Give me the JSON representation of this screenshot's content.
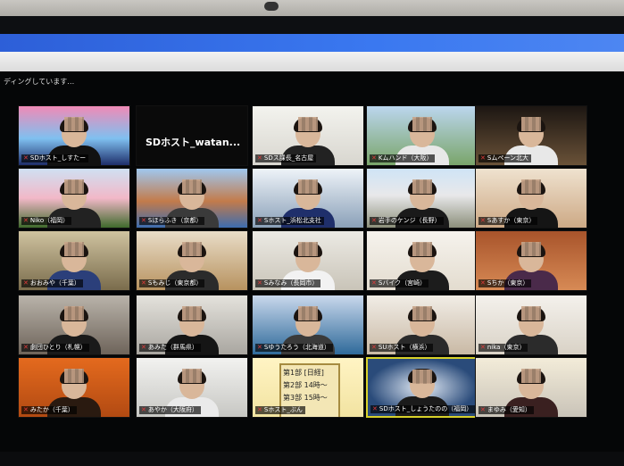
{
  "recording_text": "ディングしています…",
  "tiles": [
    {
      "name": "SDホスト_しすたー",
      "bg": "linear-gradient(#f08ab6,#7fc0f0 55%,#1e2e6a)",
      "shirt": "#111"
    },
    {
      "name": "",
      "big": "SDホスト_watan...",
      "bg": "#0a0a0a",
      "noperson": true
    },
    {
      "name": "SDス課長_名古屋",
      "bg": "linear-gradient(#f3f3ee,#d8d6cf)",
      "shirt": "#222"
    },
    {
      "name": "Kムハンド（大阪）",
      "bg": "linear-gradient(#bcd6ee,#7aa56a)",
      "shirt": "#e8e8e8"
    },
    {
      "name": "Sムペーン北大",
      "bg": "linear-gradient(#1c1612,#6a5238)",
      "shirt": "#e8e8e8"
    },
    {
      "name": "Niko（福岡）",
      "bg": "linear-gradient(#cfe0f2,#f2b8c8 50%,#3f6a2c)",
      "shirt": "#222"
    },
    {
      "name": "Sほらふき（京都）",
      "bg": "linear-gradient(#9fc7ef,#c37b4b 55%,#3d6db0)",
      "shirt": "#3a3a3a"
    },
    {
      "name": "Sホスト_浜松北支社",
      "bg": "linear-gradient(#eef3f8,#8aa0b8)",
      "shirt": "#1f2f6b"
    },
    {
      "name": "岩手のケンジ（長野）",
      "bg": "linear-gradient(#cfe4f6,#e8e8ea 45%,#8b8f7a)",
      "shirt": "#1a1a1a"
    },
    {
      "name": "Sあすか（東京）",
      "bg": "linear-gradient(#efe2cf,#cda985)",
      "shirt": "#151515"
    },
    {
      "name": "おおみや（千葉）",
      "bg": "linear-gradient(#cfc3a0,#7a6c4c)",
      "shirt": "#2b3f7a"
    },
    {
      "name": "Sもみじ（東京都）",
      "bg": "linear-gradient(#e9ddc8,#b7925f)",
      "shirt": "#2b2b2b"
    },
    {
      "name": "Sみなみ（長岡市）",
      "bg": "linear-gradient(#eceae4,#c9c4b8)",
      "shirt": "#f2f2f2"
    },
    {
      "name": "Sバイク（宮崎）",
      "bg": "linear-gradient(#f6f3ed,#e3dccf)",
      "shirt": "#1c1c1c"
    },
    {
      "name": "Sちか（東京）",
      "bg": "linear-gradient(#a8542b,#d78a55)",
      "shirt": "#4a2a4a"
    },
    {
      "name": "劇団ひとり（札幌）",
      "bg": "linear-gradient(#b9b3aa,#6e645a)",
      "shirt": "#1a1a1a"
    },
    {
      "name": "あみた（群馬県）",
      "bg": "linear-gradient(#e4e2dc,#a9a6a0)",
      "shirt": "#151515"
    },
    {
      "name": "Sゆうたろう（北海道）",
      "bg": "linear-gradient(#c9d8ec,#2f6a9a)",
      "shirt": "#3a3a3a"
    },
    {
      "name": "SUホスト（横浜）",
      "bg": "linear-gradient(#f1ede6,#c9b9a5)",
      "shirt": "#2a2a2a"
    },
    {
      "name": "nika（東京）",
      "bg": "linear-gradient(#f4f1ec,#d9d2c6)",
      "shirt": "#2b2b2b"
    },
    {
      "name": "みたか（千葉）",
      "bg": "linear-gradient(#e46a1e,#b24a12)",
      "shirt": "#2a1a10"
    },
    {
      "name": "あやか（大阪府）",
      "bg": "linear-gradient(#f2f2f0,#c7c7c3)",
      "shirt": "#eaeaea"
    },
    {
      "name": "Sホスト_ぶん",
      "bg": "linear-gradient(#fff4c4,#f2e3a1)",
      "noperson": true,
      "board": [
        "第1部 [日経]",
        "第2部 14時〜",
        "第3部 15時〜"
      ]
    },
    {
      "name": "SDホスト_しょうたのの（福岡）",
      "bg": "radial-gradient(#e6eef8,#2a4b7a 70%)",
      "shirt": "#1b1b1b",
      "active": true
    },
    {
      "name": "まゆみ（愛知）",
      "bg": "linear-gradient(#f3ecd9,#c9c3b8)",
      "shirt": "#3a2020"
    }
  ]
}
